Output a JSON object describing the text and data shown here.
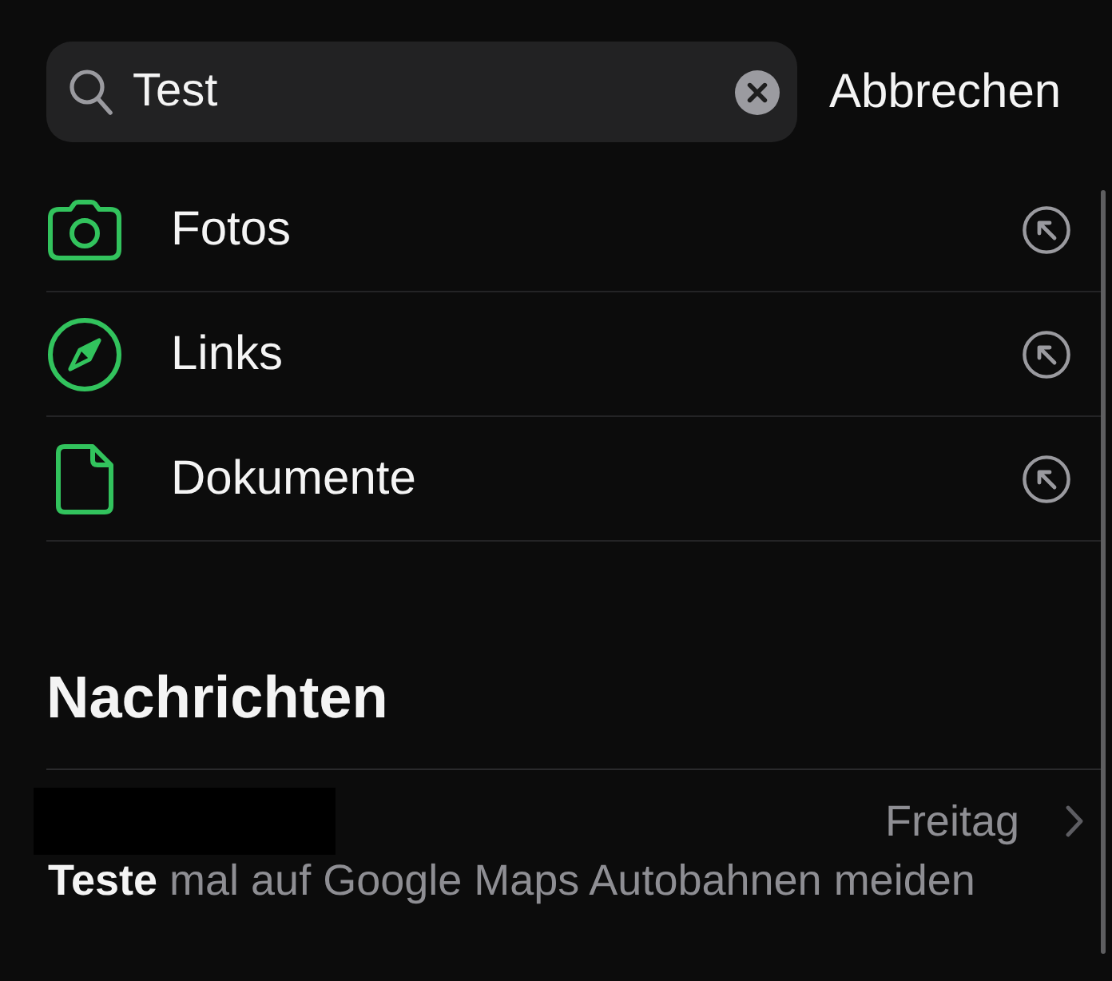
{
  "search": {
    "value": "Test",
    "cancel_label": "Abbrechen"
  },
  "categories": [
    {
      "kind": "photos",
      "label": "Fotos"
    },
    {
      "kind": "links",
      "label": "Links"
    },
    {
      "kind": "documents",
      "label": "Dokumente"
    }
  ],
  "messages_section": {
    "title": "Nachrichten",
    "results": [
      {
        "date": "Freitag",
        "preview": "**Teste** mal auf Google Maps Autobahnen meiden"
      }
    ]
  }
}
